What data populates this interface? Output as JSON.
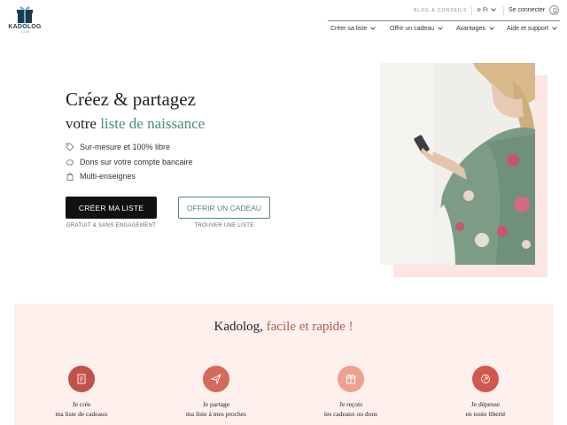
{
  "header": {
    "logo_text": "KADOLOG",
    "logo_sub": ".COM",
    "blog_link": "BLOG & CONSEILS",
    "language": "Fr",
    "login": "Se connecter",
    "nav": [
      {
        "label": "Créer sa liste"
      },
      {
        "label": "Offrir un cadeau"
      },
      {
        "label": "Avantages"
      },
      {
        "label": "Aide et support"
      }
    ]
  },
  "hero": {
    "title": "Créez & partagez",
    "subtitle_prefix": "votre ",
    "subtitle_accent": "liste de naissance",
    "features": [
      {
        "icon": "tag-icon",
        "label": "Sur-mesure et 100% libre"
      },
      {
        "icon": "piggy-bank-icon",
        "label": "Dons sur votre compte bancaire"
      },
      {
        "icon": "shopping-bag-icon",
        "label": "Multi-enseignes"
      }
    ],
    "primary_button": "CRÉER MA LISTE",
    "primary_caption": "GRATUIT & SANS ENGAGEMENT",
    "secondary_button": "OFFRIR UN CADEAU",
    "secondary_caption": "TROUVER UNE LISTE"
  },
  "section": {
    "title_prefix": "Kadolog, ",
    "title_accent": "facile et rapide !",
    "steps": [
      {
        "icon": "list-icon",
        "line1": "Je crée",
        "line2": "ma liste de cadeaux",
        "color": "#c0524a"
      },
      {
        "icon": "paper-plane-icon",
        "line1": "Je partage",
        "line2": "ma liste à mes proches",
        "color": "#d36a5c"
      },
      {
        "icon": "gift-icon",
        "line1": "Je reçois",
        "line2": "les cadeaux ou dons",
        "color": "#eca28f"
      },
      {
        "icon": "money-icon",
        "line1": "Je dépense",
        "line2": "en toute liberté",
        "color": "#d0584d"
      }
    ]
  },
  "colors": {
    "accent_teal": "#4a8a83",
    "accent_rose": "#b35a4f",
    "pink_bg": "#fdf0ed"
  }
}
